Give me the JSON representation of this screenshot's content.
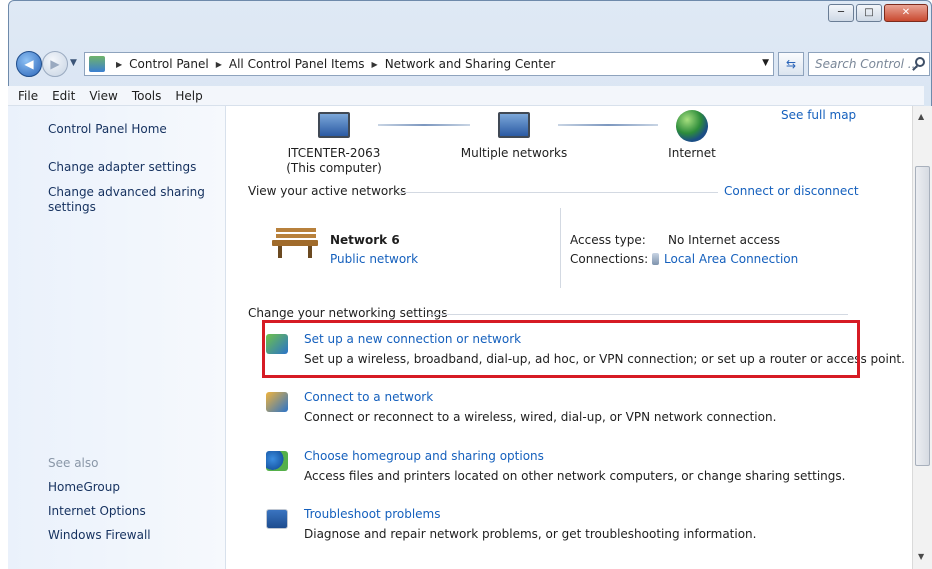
{
  "window": {
    "caption_buttons": {
      "minimize_icon": "minimize-icon",
      "maximize_icon": "maximize-icon",
      "close_icon": "close-icon"
    }
  },
  "address_bar": {
    "breadcrumbs": [
      "Control Panel",
      "All Control Panel Items",
      "Network and Sharing Center"
    ],
    "search_placeholder": "Search Control ..."
  },
  "menu": [
    "File",
    "Edit",
    "View",
    "Tools",
    "Help"
  ],
  "sidebar": {
    "links": [
      "Control Panel Home",
      "Change adapter settings",
      "Change advanced sharing settings"
    ],
    "see_also_label": "See also",
    "see_also_links": [
      "HomeGroup",
      "Internet Options",
      "Windows Firewall"
    ]
  },
  "network_map": {
    "see_full_map": "See full map",
    "computer_name": "ITCENTER-2063",
    "computer_sub": "(This computer)",
    "middle_node": "Multiple networks",
    "internet": "Internet"
  },
  "active_networks": {
    "heading": "View your active networks",
    "connect_link": "Connect or disconnect",
    "network_name": "Network  6",
    "network_type": "Public network",
    "access_type_label": "Access type:",
    "access_type_value": "No Internet access",
    "connections_label": "Connections:",
    "connections_value": "Local Area Connection"
  },
  "settings": {
    "heading": "Change your networking settings",
    "tasks": [
      {
        "title": "Set up a new connection or network",
        "desc": "Set up a wireless, broadband, dial-up, ad hoc, or VPN connection; or set up a router or access point.",
        "icon": "new-connection-icon"
      },
      {
        "title": "Connect to a network",
        "desc": "Connect or reconnect to a wireless, wired, dial-up, or VPN network connection.",
        "icon": "connect-network-icon"
      },
      {
        "title": "Choose homegroup and sharing options",
        "desc": "Access files and printers located on other network computers, or change sharing settings.",
        "icon": "homegroup-icon"
      },
      {
        "title": "Troubleshoot problems",
        "desc": "Diagnose and repair network problems, or get troubleshooting information.",
        "icon": "troubleshoot-icon"
      }
    ]
  },
  "colors": {
    "link": "#1560bd",
    "highlight": "#d61b24"
  }
}
